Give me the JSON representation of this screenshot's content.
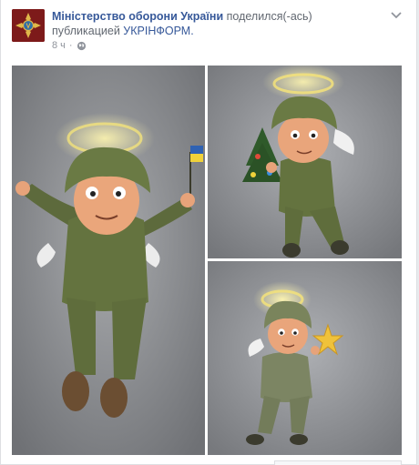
{
  "post": {
    "author": "Міністерство оборони України",
    "action": "поделился(-ась)",
    "shared_prefix": "публикацией",
    "shared_source": "УКРІНФОРМ.",
    "timestamp": "8 ч",
    "audience_icon": "globe-icon",
    "menu_icon": "chevron-down-icon"
  },
  "photos": [
    {
      "name": "angel-soldier-with-flag",
      "icon": "image"
    },
    {
      "name": "angel-soldier-with-christmas-tree",
      "icon": "image"
    },
    {
      "name": "angel-soldier-with-star",
      "icon": "image"
    }
  ],
  "colors": {
    "link": "#365899",
    "muted": "#616770",
    "avatar_bg": "#8b1d1d",
    "emblem_gold": "#e0b84a"
  }
}
